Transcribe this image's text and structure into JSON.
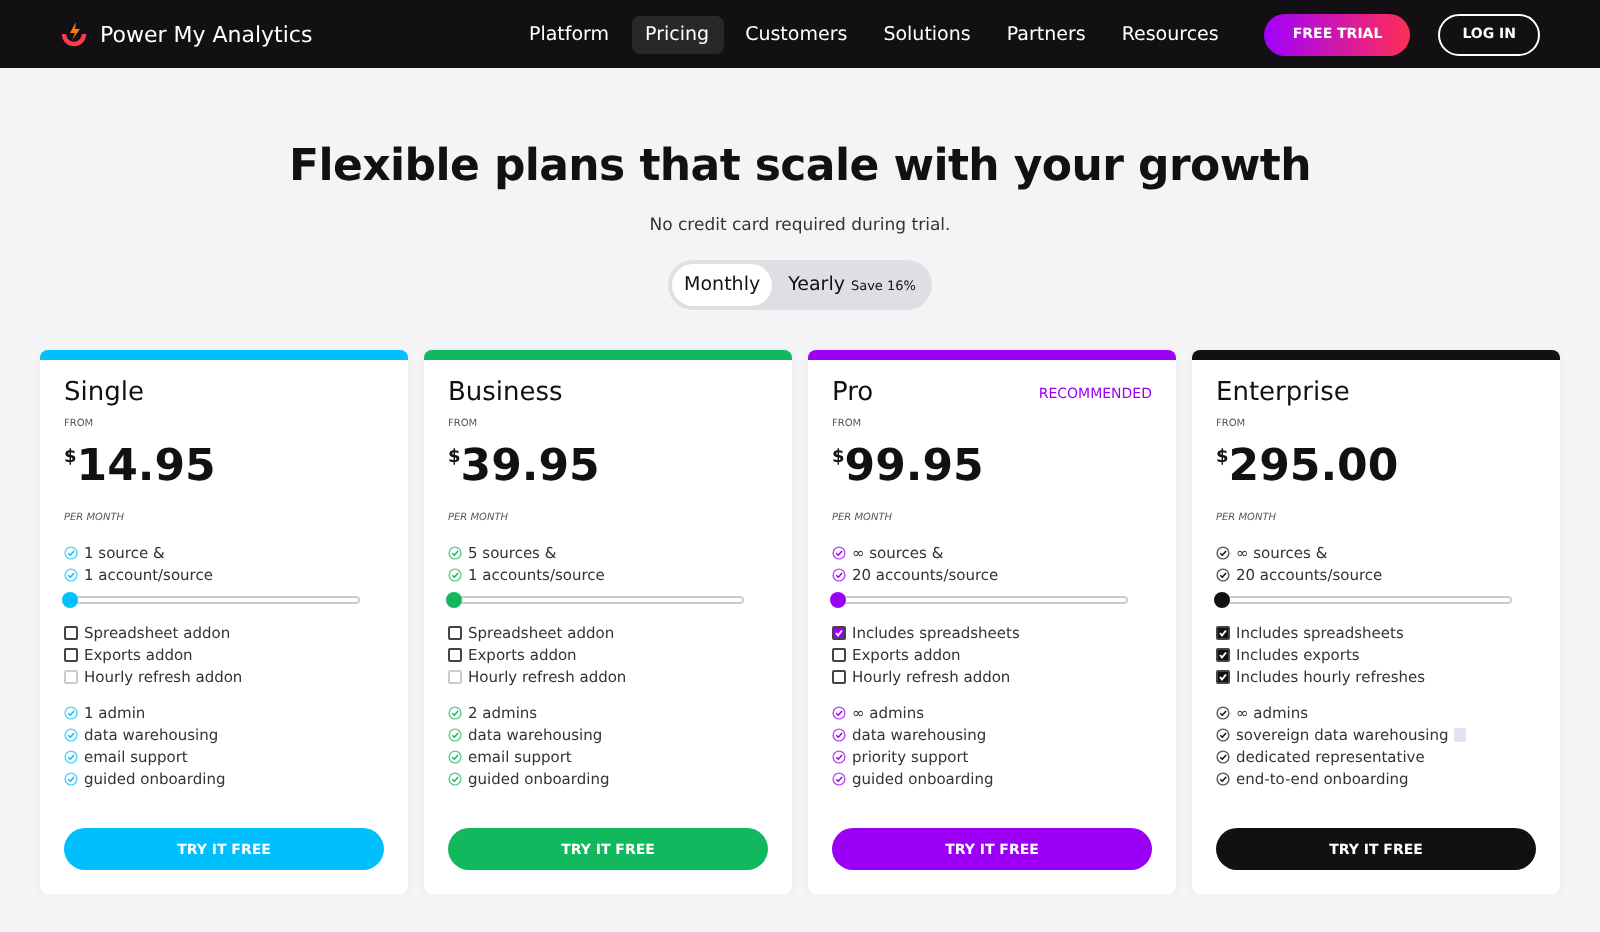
{
  "nav": {
    "brand": "Power My Analytics",
    "links": [
      {
        "label": "Platform",
        "selected": false
      },
      {
        "label": "Pricing",
        "selected": true
      },
      {
        "label": "Customers",
        "selected": false
      },
      {
        "label": "Solutions",
        "selected": false
      },
      {
        "label": "Partners",
        "selected": false
      },
      {
        "label": "Resources",
        "selected": false
      }
    ],
    "trial_button": "FREE TRIAL",
    "login_button": "LOG IN"
  },
  "heading": "Flexible plans that scale with your growth",
  "subheading": "No credit card required during trial.",
  "billing_toggle": [
    {
      "label": "Monthly",
      "selected": true
    },
    {
      "label": "Yearly",
      "note": "Save 16%",
      "selected": false
    }
  ],
  "plans": [
    {
      "name": "Single",
      "color": "#00bfff",
      "from": "FROM",
      "currency": "$",
      "price": "14.95",
      "period": "PER MONTH",
      "limits": [
        "1 source &",
        "1 account/source"
      ],
      "level": 0,
      "addons": [
        {
          "label": "Spreadsheet addon",
          "checked": false,
          "disabled": false
        },
        {
          "label": "Exports addon",
          "checked": false,
          "disabled": false
        },
        {
          "label": "Hourly refresh addon",
          "checked": false,
          "disabled": true
        }
      ],
      "features": [
        {
          "label": "1 admin"
        },
        {
          "label": "data warehousing"
        },
        {
          "label": "email support"
        },
        {
          "label": "guided onboarding"
        }
      ],
      "button": "TRY IT FREE"
    },
    {
      "name": "Business",
      "color": "#12b85e",
      "from": "FROM",
      "currency": "$",
      "price": "39.95",
      "period": "PER MONTH",
      "limits": [
        "5 sources &",
        "1 accounts/source"
      ],
      "level": 0,
      "addons": [
        {
          "label": "Spreadsheet addon",
          "checked": false,
          "disabled": false
        },
        {
          "label": "Exports addon",
          "checked": false,
          "disabled": false
        },
        {
          "label": "Hourly refresh addon",
          "checked": false,
          "disabled": true
        }
      ],
      "features": [
        {
          "label": "2 admins"
        },
        {
          "label": "data warehousing"
        },
        {
          "label": "email support"
        },
        {
          "label": "guided onboarding"
        }
      ],
      "button": "TRY IT FREE"
    },
    {
      "name": "Pro",
      "badge": "RECOMMENDED",
      "color": "#9b00f5",
      "from": "FROM",
      "currency": "$",
      "price": "99.95",
      "period": "PER MONTH",
      "limits": [
        "∞ sources &",
        "20 accounts/source"
      ],
      "level": 0,
      "addons": [
        {
          "label": "Includes spreadsheets",
          "checked": true,
          "disabled": false
        },
        {
          "label": "Exports addon",
          "checked": false,
          "disabled": false
        },
        {
          "label": "Hourly refresh addon",
          "checked": false,
          "disabled": false
        }
      ],
      "features": [
        {
          "label": "∞ admins"
        },
        {
          "label": "data warehousing"
        },
        {
          "label": "priority support"
        },
        {
          "label": "guided onboarding"
        }
      ],
      "button": "TRY IT FREE"
    },
    {
      "name": "Enterprise",
      "color": "#111111",
      "from": "FROM",
      "currency": "$",
      "price": "295.00",
      "period": "PER MONTH",
      "limits": [
        "∞ sources &",
        "20 accounts/source"
      ],
      "level": 0,
      "addons": [
        {
          "label": "Includes spreadsheets",
          "checked": true,
          "disabled": false
        },
        {
          "label": "Includes exports",
          "checked": true,
          "disabled": false
        },
        {
          "label": "Includes hourly refreshes",
          "checked": true,
          "disabled": false
        }
      ],
      "features": [
        {
          "label": "∞ admins"
        },
        {
          "label": "sovereign data warehousing",
          "note_icon": true
        },
        {
          "label": "dedicated representative"
        },
        {
          "label": "end-to-end onboarding"
        }
      ],
      "button": "TRY IT FREE"
    }
  ]
}
